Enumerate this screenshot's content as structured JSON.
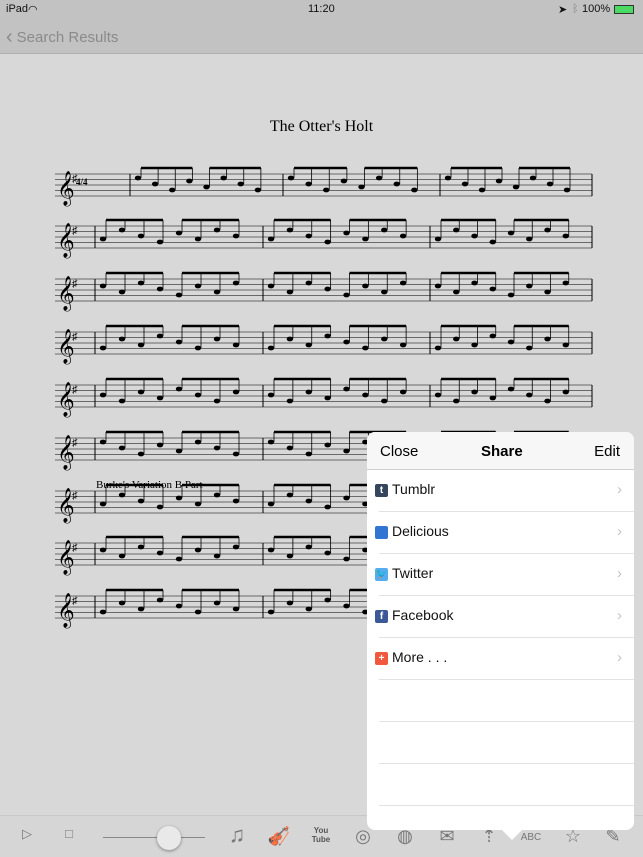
{
  "status": {
    "device": "iPad",
    "time": "11:20",
    "battery": "100%"
  },
  "nav": {
    "back_label": "Search Results"
  },
  "sheet": {
    "title": "The Otter's Holt",
    "variation_label": "Burke's Variation B Part",
    "time_signature": "4/4",
    "triplet": "3",
    "endings": [
      "1",
      "2"
    ]
  },
  "popover": {
    "close": "Close",
    "title": "Share",
    "edit": "Edit",
    "items": [
      {
        "label": "Tumblr",
        "icon": "tumblr-icon",
        "color": "#35465c",
        "glyph": "t"
      },
      {
        "label": "Delicious",
        "icon": "delicious-icon",
        "color": "#3274d1",
        "glyph": ""
      },
      {
        "label": "Twitter",
        "icon": "twitter-icon",
        "color": "#55acee",
        "glyph": "🐦"
      },
      {
        "label": "Facebook",
        "icon": "facebook-icon",
        "color": "#3b5998",
        "glyph": "f"
      },
      {
        "label": "More . . .",
        "icon": "plus-icon",
        "color": "#f0593e",
        "glyph": "+"
      }
    ]
  },
  "toolbar": {
    "abc_label": "ABC",
    "youtube_label": "You Tube",
    "tempo_level": 0.66
  }
}
